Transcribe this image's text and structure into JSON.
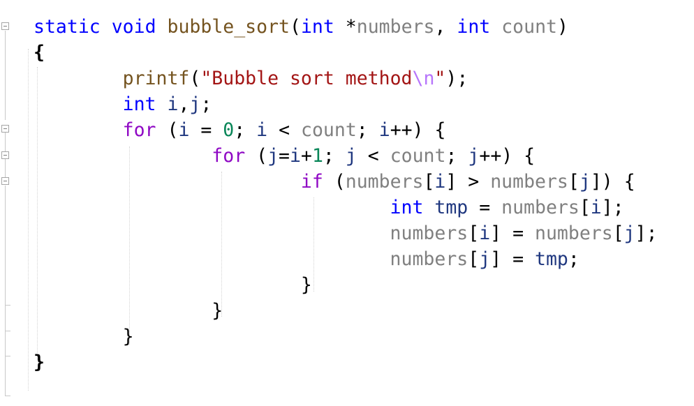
{
  "lines": [
    [
      {
        "t": "static",
        "c": "tok-keyword"
      },
      {
        "t": " ",
        "c": ""
      },
      {
        "t": "void",
        "c": "tok-keyword"
      },
      {
        "t": " ",
        "c": ""
      },
      {
        "t": "bubble_sort",
        "c": "tok-func"
      },
      {
        "t": "(",
        "c": "tok-punct"
      },
      {
        "t": "int",
        "c": "tok-keyword"
      },
      {
        "t": " *",
        "c": "tok-punct"
      },
      {
        "t": "numbers",
        "c": "tok-param"
      },
      {
        "t": ", ",
        "c": "tok-punct"
      },
      {
        "t": "int",
        "c": "tok-keyword"
      },
      {
        "t": " ",
        "c": ""
      },
      {
        "t": "count",
        "c": "tok-param"
      },
      {
        "t": ")",
        "c": "tok-punct"
      }
    ],
    [
      {
        "t": "{",
        "c": "tok-punct bold"
      }
    ],
    [
      {
        "t": "        ",
        "c": ""
      },
      {
        "t": "printf",
        "c": "tok-func"
      },
      {
        "t": "(",
        "c": "tok-punct"
      },
      {
        "t": "\"Bubble sort method",
        "c": "tok-string"
      },
      {
        "t": "\\n",
        "c": "tok-escape"
      },
      {
        "t": "\"",
        "c": "tok-string"
      },
      {
        "t": ");",
        "c": "tok-punct"
      }
    ],
    [
      {
        "t": "        ",
        "c": ""
      },
      {
        "t": "int",
        "c": "tok-keyword"
      },
      {
        "t": " ",
        "c": ""
      },
      {
        "t": "i",
        "c": "tok-local"
      },
      {
        "t": ",",
        "c": "tok-punct"
      },
      {
        "t": "j",
        "c": "tok-local"
      },
      {
        "t": ";",
        "c": "tok-punct"
      }
    ],
    [
      {
        "t": "        ",
        "c": ""
      },
      {
        "t": "for",
        "c": "tok-control"
      },
      {
        "t": " (",
        "c": "tok-punct"
      },
      {
        "t": "i",
        "c": "tok-local"
      },
      {
        "t": " = ",
        "c": "tok-punct"
      },
      {
        "t": "0",
        "c": "tok-number"
      },
      {
        "t": "; ",
        "c": "tok-punct"
      },
      {
        "t": "i",
        "c": "tok-local"
      },
      {
        "t": " < ",
        "c": "tok-punct"
      },
      {
        "t": "count",
        "c": "tok-param"
      },
      {
        "t": "; ",
        "c": "tok-punct"
      },
      {
        "t": "i",
        "c": "tok-local"
      },
      {
        "t": "++) {",
        "c": "tok-punct"
      }
    ],
    [
      {
        "t": "                ",
        "c": ""
      },
      {
        "t": "for",
        "c": "tok-control"
      },
      {
        "t": " (",
        "c": "tok-punct"
      },
      {
        "t": "j",
        "c": "tok-local"
      },
      {
        "t": "=",
        "c": "tok-punct"
      },
      {
        "t": "i",
        "c": "tok-local"
      },
      {
        "t": "+",
        "c": "tok-punct"
      },
      {
        "t": "1",
        "c": "tok-number"
      },
      {
        "t": "; ",
        "c": "tok-punct"
      },
      {
        "t": "j",
        "c": "tok-local"
      },
      {
        "t": " < ",
        "c": "tok-punct"
      },
      {
        "t": "count",
        "c": "tok-param"
      },
      {
        "t": "; ",
        "c": "tok-punct"
      },
      {
        "t": "j",
        "c": "tok-local"
      },
      {
        "t": "++) {",
        "c": "tok-punct"
      }
    ],
    [
      {
        "t": "                        ",
        "c": ""
      },
      {
        "t": "if",
        "c": "tok-control"
      },
      {
        "t": " (",
        "c": "tok-punct"
      },
      {
        "t": "numbers",
        "c": "tok-param"
      },
      {
        "t": "[",
        "c": "tok-punct"
      },
      {
        "t": "i",
        "c": "tok-local"
      },
      {
        "t": "] > ",
        "c": "tok-punct"
      },
      {
        "t": "numbers",
        "c": "tok-param"
      },
      {
        "t": "[",
        "c": "tok-punct"
      },
      {
        "t": "j",
        "c": "tok-local"
      },
      {
        "t": "]) {",
        "c": "tok-punct"
      }
    ],
    [
      {
        "t": "                                ",
        "c": ""
      },
      {
        "t": "int",
        "c": "tok-keyword"
      },
      {
        "t": " ",
        "c": ""
      },
      {
        "t": "tmp",
        "c": "tok-local"
      },
      {
        "t": " = ",
        "c": "tok-punct"
      },
      {
        "t": "numbers",
        "c": "tok-param"
      },
      {
        "t": "[",
        "c": "tok-punct"
      },
      {
        "t": "i",
        "c": "tok-local"
      },
      {
        "t": "];",
        "c": "tok-punct"
      }
    ],
    [
      {
        "t": "                                ",
        "c": ""
      },
      {
        "t": "numbers",
        "c": "tok-param"
      },
      {
        "t": "[",
        "c": "tok-punct"
      },
      {
        "t": "i",
        "c": "tok-local"
      },
      {
        "t": "] = ",
        "c": "tok-punct"
      },
      {
        "t": "numbers",
        "c": "tok-param"
      },
      {
        "t": "[",
        "c": "tok-punct"
      },
      {
        "t": "j",
        "c": "tok-local"
      },
      {
        "t": "];",
        "c": "tok-punct"
      }
    ],
    [
      {
        "t": "                                ",
        "c": ""
      },
      {
        "t": "numbers",
        "c": "tok-param"
      },
      {
        "t": "[",
        "c": "tok-punct"
      },
      {
        "t": "j",
        "c": "tok-local"
      },
      {
        "t": "] = ",
        "c": "tok-punct"
      },
      {
        "t": "tmp",
        "c": "tok-local"
      },
      {
        "t": ";",
        "c": "tok-punct"
      }
    ],
    [
      {
        "t": "                        ",
        "c": ""
      },
      {
        "t": "}",
        "c": "tok-punct"
      }
    ],
    [
      {
        "t": "                ",
        "c": ""
      },
      {
        "t": "}",
        "c": "tok-punct"
      }
    ],
    [
      {
        "t": "        ",
        "c": ""
      },
      {
        "t": "}",
        "c": "tok-punct"
      }
    ],
    [
      {
        "t": "}",
        "c": "tok-punct bold"
      }
    ]
  ]
}
